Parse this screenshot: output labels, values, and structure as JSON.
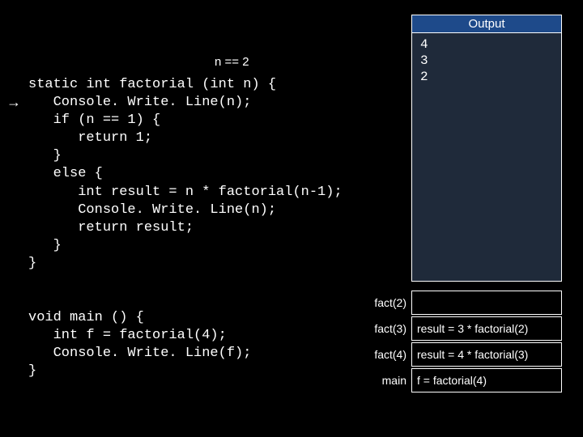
{
  "output": {
    "header": "Output",
    "lines": "4\n3\n2"
  },
  "annotation": {
    "n_value": "n == 2"
  },
  "arrow_glyph": "→",
  "code_block_1": "static int factorial (int n) {\n   Console. Write. Line(n);\n   if (n == 1) {\n      return 1;\n   }\n   else {\n      int result = n * factorial(n-1);\n      Console. Write. Line(n);\n      return result;\n   }\n}",
  "code_block_2": "void main () {\n   int f = factorial(4);\n   Console. Write. Line(f);\n}",
  "stack": [
    {
      "label": "fact(2)",
      "content": ""
    },
    {
      "label": "fact(3)",
      "content": "result = 3 * factorial(2)"
    },
    {
      "label": "fact(4)",
      "content": "result = 4 * factorial(3)"
    },
    {
      "label": "main",
      "content": "f = factorial(4)"
    }
  ]
}
